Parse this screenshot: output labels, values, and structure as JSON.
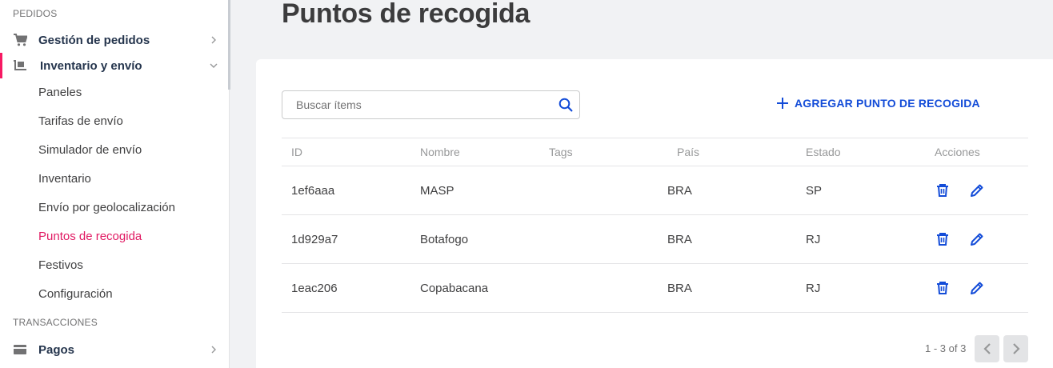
{
  "sidebar": {
    "sections": [
      {
        "title": "PEDIDOS",
        "groups": [
          {
            "label": "Gestión de pedidos",
            "icon": "cart-icon",
            "expanded": false
          },
          {
            "label": "Inventario y envío",
            "icon": "forklift-icon",
            "expanded": true,
            "items": [
              {
                "label": "Paneles"
              },
              {
                "label": "Tarifas de envío"
              },
              {
                "label": "Simulador de envío"
              },
              {
                "label": "Inventario"
              },
              {
                "label": "Envío por geolocalización"
              },
              {
                "label": "Puntos de recogida",
                "current": true
              },
              {
                "label": "Festivos"
              },
              {
                "label": "Configuración"
              }
            ]
          }
        ]
      },
      {
        "title": "TRANSACCIONES",
        "groups": [
          {
            "label": "Pagos",
            "icon": "credit-card-icon",
            "expanded": false
          }
        ]
      }
    ]
  },
  "page": {
    "title": "Puntos de recogida"
  },
  "search": {
    "placeholder": "Buscar ítems",
    "value": ""
  },
  "add_button": {
    "label": "AGREGAR PUNTO DE RECOGIDA"
  },
  "table": {
    "headers": {
      "id": "ID",
      "name": "Nombre",
      "tags": "Tags",
      "country": "País",
      "state": "Estado",
      "actions": "Acciones"
    },
    "rows": [
      {
        "id": "1ef6aaa",
        "name": "MASP",
        "tags": "",
        "country": "BRA",
        "state": "SP"
      },
      {
        "id": "1d929a7",
        "name": "Botafogo",
        "tags": "",
        "country": "BRA",
        "state": "RJ"
      },
      {
        "id": "1eac206",
        "name": "Copabacana",
        "tags": "",
        "country": "BRA",
        "state": "RJ"
      }
    ]
  },
  "pagination": {
    "text": "1 - 3 of 3"
  },
  "colors": {
    "accent": "#f71963",
    "link": "#134cd8",
    "current_item": "#e11a63",
    "text": "#25354d"
  }
}
